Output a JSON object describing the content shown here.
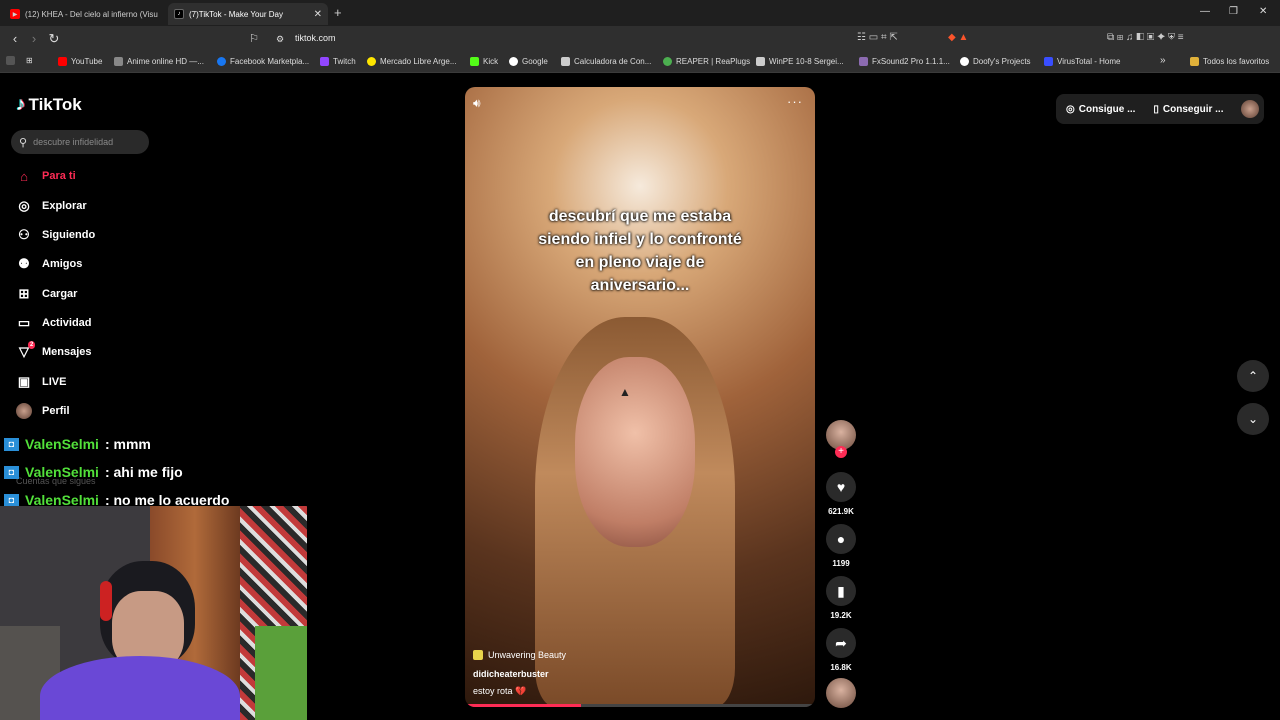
{
  "browser": {
    "tabs": [
      {
        "title": "(12) KHEA - Del cielo al infierno (Visu"
      },
      {
        "title": "(7)TikTok - Make Your Day"
      }
    ],
    "url": "tiktok.com",
    "bookmarks": [
      {
        "label": "YouTube",
        "color": "#ff0000"
      },
      {
        "label": "Anime online HD —...",
        "color": "#888888"
      },
      {
        "label": "Facebook Marketpla...",
        "color": "#1877f2"
      },
      {
        "label": "Twitch",
        "color": "#9146ff"
      },
      {
        "label": "Mercado Libre Arge...",
        "color": "#ffe600"
      },
      {
        "label": "Kick",
        "color": "#53fc18"
      },
      {
        "label": "Google",
        "color": "#ffffff"
      },
      {
        "label": "Calculadora de Con...",
        "color": "#cccccc"
      },
      {
        "label": "REAPER | ReaPlugs",
        "color": "#4caf50"
      },
      {
        "label": "WinPE 10-8 Sergei...",
        "color": "#cccccc"
      },
      {
        "label": "FxSound2 Pro 1.1.1...",
        "color": "#8c6bb1"
      },
      {
        "label": "Doofy's Projects",
        "color": "#ffffff"
      },
      {
        "label": "VirusTotal - Home",
        "color": "#394eff"
      }
    ],
    "bookmarks_all": "Todos los favoritos"
  },
  "tiktok": {
    "logo": "TikTok",
    "search_placeholder": "descubre infidelidad",
    "nav": [
      {
        "label": "Para ti",
        "icon": "home-icon"
      },
      {
        "label": "Explorar",
        "icon": "compass-icon"
      },
      {
        "label": "Siguiendo",
        "icon": "following-icon"
      },
      {
        "label": "Amigos",
        "icon": "friends-icon"
      },
      {
        "label": "Cargar",
        "icon": "upload-icon"
      },
      {
        "label": "Actividad",
        "icon": "activity-icon"
      },
      {
        "label": "Mensajes",
        "icon": "messages-icon",
        "badge": "2"
      },
      {
        "label": "LIVE",
        "icon": "live-icon"
      },
      {
        "label": "Perfil",
        "icon": "profile-icon"
      }
    ],
    "following_section": "Cuentas que sigues",
    "topright": {
      "coins": "Consigue ...",
      "app": "Conseguir ..."
    },
    "video": {
      "caption": [
        "descubrí que me estaba",
        "siendo infiel y lo confronté",
        "en pleno viaje de",
        "aniversario..."
      ],
      "sound": "Unwavering Beauty",
      "author": "didicheaterbuster",
      "description": "estoy rota 💔",
      "progress": 0.33
    },
    "actions": {
      "likes": "621.9K",
      "comments": "1199",
      "saves": "19.2K",
      "shares": "16.8K"
    }
  },
  "chat": [
    {
      "user": "ValenSelmi",
      "message": ": mmm"
    },
    {
      "user": "ValenSelmi",
      "message": ": ahi me fijo"
    },
    {
      "user": "ValenSelmi",
      "message": ": no me lo acuerdo"
    }
  ]
}
